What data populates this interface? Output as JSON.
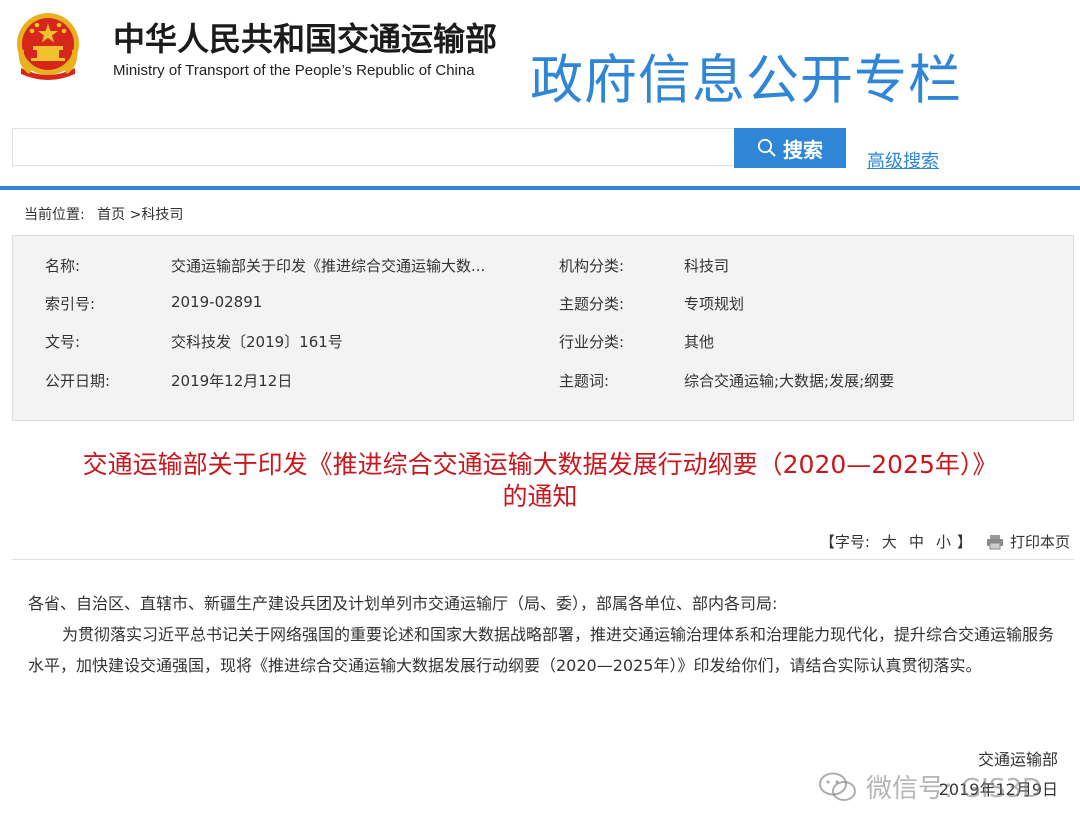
{
  "header": {
    "ministry_cn": "中华人民共和国交通运输部",
    "ministry_en": "Ministry of Transport of the People’s Republic of China",
    "column_title": "政府信息公开专栏"
  },
  "search": {
    "value": "",
    "button_label": "搜索",
    "advanced_label": "高级搜索"
  },
  "breadcrumb": {
    "prefix": "当前位置:",
    "home": "首页",
    "current": ">科技司"
  },
  "info": {
    "name_label": "名称:",
    "name_value": "交通运输部关于印发《推进综合交通运输大数...",
    "index_label": "索引号:",
    "index_value": "2019-02891",
    "docno_label": "文号:",
    "docno_value": "交科技发〔2019〕161号",
    "date_label": "公开日期:",
    "date_value": "2019年12月12日",
    "org_label": "机构分类:",
    "org_value": "科技司",
    "topic_label": "主题分类:",
    "topic_value": "专项规划",
    "industry_label": "行业分类:",
    "industry_value": "其他",
    "keywords_label": "主题词:",
    "keywords_value": "综合交通运输;大数据;发展;纲要"
  },
  "document": {
    "title_line1": "交通运输部关于印发《推进综合交通运输大数据发展行动纲要（2020—2025年）》",
    "title_line2": "的通知",
    "font_size_open": "【字号:",
    "font_large": "大",
    "font_medium": "中",
    "font_small": "小",
    "font_size_close": "】",
    "print_label": "打印本页",
    "salutation": "各省、自治区、直辖市、新疆生产建设兵团及计划单列市交通运输厅（局、委），部属各单位、部内各司局:",
    "body": "为贯彻落实习近平总书记关于网络强国的重要论述和国家大数据战略部署，推进交通运输治理体系和治理能力现代化，提升综合交通运输服务水平，加快建设交通强国，现将《推进综合交通运输大数据发展行动纲要（2020—2025年）》印发给你们，请结合实际认真贯彻落实。",
    "signature": "交通运输部",
    "sign_date": "2019年12月9日"
  },
  "watermark": {
    "text": "微信号: GIS3D",
    "icon": "wechat-icon"
  },
  "colors": {
    "accent_blue": "#2f86d6",
    "title_red": "#c9171e",
    "emblem_red": "#d7261b",
    "emblem_gold": "#f2c12e"
  }
}
